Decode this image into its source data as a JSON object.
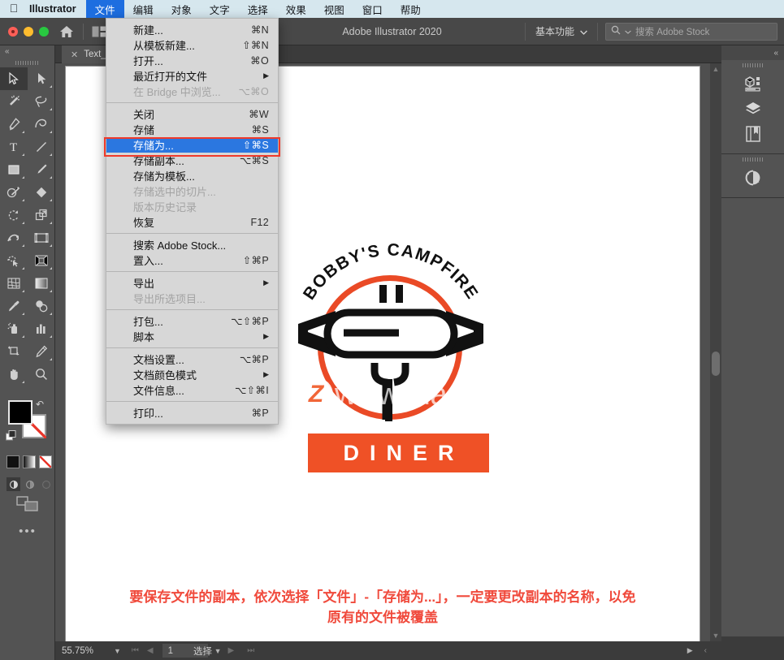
{
  "macbar": {
    "apple_icon": "apple-icon",
    "app_name": "Illustrator",
    "menus": [
      {
        "label": "文件",
        "active": true
      },
      {
        "label": "编辑",
        "active": false
      },
      {
        "label": "对象",
        "active": false
      },
      {
        "label": "文字",
        "active": false
      },
      {
        "label": "选择",
        "active": false
      },
      {
        "label": "效果",
        "active": false
      },
      {
        "label": "视图",
        "active": false
      },
      {
        "label": "窗口",
        "active": false
      },
      {
        "label": "帮助",
        "active": false
      }
    ]
  },
  "titlebar": {
    "title": "Adobe Illustrator 2020",
    "home_icon": "home-icon",
    "arrange_icon": "arrange-documents-icon",
    "workspace_label": "基本功能",
    "workspace_caret": "chevron-down-icon",
    "search": {
      "icon": "search-icon",
      "caret": "chevron-down-icon",
      "placeholder": "搜索 Adobe Stock",
      "value": ""
    }
  },
  "tab": {
    "close_icon": "close-icon",
    "label": "Text_C"
  },
  "file_menu": {
    "items": [
      {
        "label": "新建...",
        "key": "⌘N",
        "dim": false,
        "sep_after": false,
        "submenu": false,
        "highlight": false
      },
      {
        "label": "从模板新建...",
        "key": "⇧⌘N",
        "dim": false,
        "sep_after": false,
        "submenu": false,
        "highlight": false
      },
      {
        "label": "打开...",
        "key": "⌘O",
        "dim": false,
        "sep_after": false,
        "submenu": false,
        "highlight": false
      },
      {
        "label": "最近打开的文件",
        "key": "",
        "dim": false,
        "sep_after": false,
        "submenu": true,
        "highlight": false
      },
      {
        "label": "在 Bridge 中浏览...",
        "key": "⌥⌘O",
        "dim": true,
        "sep_after": true,
        "submenu": false,
        "highlight": false
      },
      {
        "label": "关闭",
        "key": "⌘W",
        "dim": false,
        "sep_after": false,
        "submenu": false,
        "highlight": false
      },
      {
        "label": "存储",
        "key": "⌘S",
        "dim": false,
        "sep_after": false,
        "submenu": false,
        "highlight": false
      },
      {
        "label": "存储为...",
        "key": "⇧⌘S",
        "dim": false,
        "sep_after": false,
        "submenu": false,
        "highlight": true
      },
      {
        "label": "存储副本...",
        "key": "⌥⌘S",
        "dim": false,
        "sep_after": false,
        "submenu": false,
        "highlight": false
      },
      {
        "label": "存储为模板...",
        "key": "",
        "dim": false,
        "sep_after": false,
        "submenu": false,
        "highlight": false
      },
      {
        "label": "存储选中的切片...",
        "key": "",
        "dim": true,
        "sep_after": false,
        "submenu": false,
        "highlight": false
      },
      {
        "label": "版本历史记录",
        "key": "",
        "dim": true,
        "sep_after": false,
        "submenu": false,
        "highlight": false
      },
      {
        "label": "恢复",
        "key": "F12",
        "dim": false,
        "sep_after": true,
        "submenu": false,
        "highlight": false
      },
      {
        "label": "搜索 Adobe Stock...",
        "key": "",
        "dim": false,
        "sep_after": false,
        "submenu": false,
        "highlight": false
      },
      {
        "label": "置入...",
        "key": "⇧⌘P",
        "dim": false,
        "sep_after": true,
        "submenu": false,
        "highlight": false
      },
      {
        "label": "导出",
        "key": "",
        "dim": false,
        "sep_after": false,
        "submenu": true,
        "highlight": false
      },
      {
        "label": "导出所选项目...",
        "key": "",
        "dim": true,
        "sep_after": true,
        "submenu": false,
        "highlight": false
      },
      {
        "label": "打包...",
        "key": "⌥⇧⌘P",
        "dim": false,
        "sep_after": false,
        "submenu": false,
        "highlight": false
      },
      {
        "label": "脚本",
        "key": "",
        "dim": false,
        "sep_after": true,
        "submenu": true,
        "highlight": false
      },
      {
        "label": "文档设置...",
        "key": "⌥⌘P",
        "dim": false,
        "sep_after": false,
        "submenu": false,
        "highlight": false
      },
      {
        "label": "文档颜色模式",
        "key": "",
        "dim": false,
        "sep_after": false,
        "submenu": true,
        "highlight": false
      },
      {
        "label": "文件信息...",
        "key": "⌥⇧⌘I",
        "dim": false,
        "sep_after": true,
        "submenu": false,
        "highlight": false
      },
      {
        "label": "打印...",
        "key": "⌘P",
        "dim": false,
        "sep_after": false,
        "submenu": false,
        "highlight": false
      }
    ],
    "highlight_box_color": "#ef3a2b",
    "highlight_row_color": "#2b77e0"
  },
  "toolbar": {
    "collapse_icon": "collapse-panel-icon",
    "tools": [
      {
        "name": "selection-tool",
        "selected": true
      },
      {
        "name": "direct-selection-tool",
        "selected": false
      },
      {
        "name": "magic-wand-tool",
        "selected": false
      },
      {
        "name": "lasso-tool",
        "selected": false
      },
      {
        "name": "pen-tool",
        "selected": false
      },
      {
        "name": "curvature-tool",
        "selected": false
      },
      {
        "name": "type-tool",
        "selected": false
      },
      {
        "name": "line-segment-tool",
        "selected": false
      },
      {
        "name": "rectangle-tool",
        "selected": false
      },
      {
        "name": "paintbrush-tool",
        "selected": false
      },
      {
        "name": "shaper-tool",
        "selected": false
      },
      {
        "name": "eraser-tool",
        "selected": false
      },
      {
        "name": "rotate-tool",
        "selected": false
      },
      {
        "name": "scale-tool",
        "selected": false
      },
      {
        "name": "width-tool",
        "selected": false
      },
      {
        "name": "free-transform-tool",
        "selected": false
      },
      {
        "name": "shape-builder-tool",
        "selected": false
      },
      {
        "name": "perspective-grid-tool",
        "selected": false
      },
      {
        "name": "mesh-tool",
        "selected": false
      },
      {
        "name": "gradient-tool",
        "selected": false
      },
      {
        "name": "eyedropper-tool",
        "selected": false
      },
      {
        "name": "blend-tool",
        "selected": false
      },
      {
        "name": "symbol-sprayer-tool",
        "selected": false
      },
      {
        "name": "column-graph-tool",
        "selected": false
      },
      {
        "name": "artboard-tool",
        "selected": false
      },
      {
        "name": "slice-tool",
        "selected": false
      },
      {
        "name": "hand-tool",
        "selected": false
      },
      {
        "name": "zoom-tool",
        "selected": false
      }
    ],
    "fill_color": "#000000",
    "stroke_color": "#ffffff",
    "swap_icon": "swap-fill-stroke-icon",
    "default_icon": "default-fill-stroke-icon",
    "mini_swatches": [
      "color-swatch",
      "gradient-swatch",
      "none-swatch"
    ],
    "screen_modes": [
      "normal-screen-mode",
      "full-screen-menubar-mode",
      "full-screen-mode"
    ],
    "edit_toolbar_icon": "edit-toolbar-icon",
    "more_icon": "more-options-icon"
  },
  "right_panel": {
    "collapse_icon": "collapse-panel-icon",
    "items": [
      {
        "name": "properties-panel-icon"
      },
      {
        "name": "layers-panel-icon"
      },
      {
        "name": "libraries-panel-icon"
      },
      {
        "name": "recolor-artwork-panel-icon"
      }
    ]
  },
  "artwork": {
    "arc_text": "BOBBY'S CAMPFIRE",
    "bottom_text": "DINER",
    "ring_color": "#ea4a26",
    "banner_color": "#ef5126",
    "hotdog_color": "#111111"
  },
  "watermark": {
    "badge": "Z",
    "text": "www.MacZ.com"
  },
  "caption": {
    "line1": "要保存文件的副本，依次选择「文件」-「存储为...」，一定要更改副本的名称，以免",
    "line2": "原有的文件被覆盖",
    "color": "#f04a3c"
  },
  "statusbar": {
    "zoom": "55.75%",
    "zoom_caret": "chevron-down-icon",
    "nav_first_icon": "first-artboard-icon",
    "nav_prev_icon": "prev-artboard-icon",
    "page": "1",
    "page_caret": "chevron-down-icon",
    "nav_next_icon": "next-artboard-icon",
    "nav_last_icon": "last-artboard-icon",
    "status_text": "选择",
    "status_caret": "status-menu-icon",
    "resize_icon": "resize-grip-icon"
  }
}
